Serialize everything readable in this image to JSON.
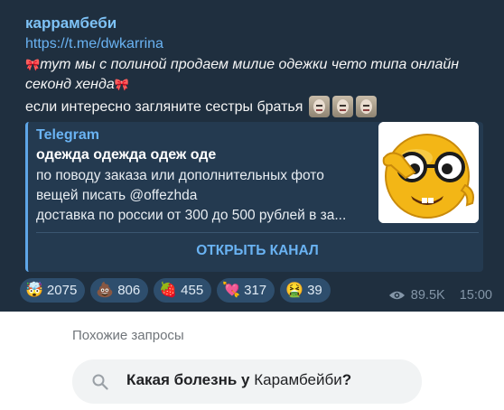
{
  "message": {
    "sender": "каррамбеби",
    "link": "https://t.me/dwkarrina",
    "line1_bow": "🎀",
    "line1_text": "тут мы с полиной продаем милие одежки чето типа онлайн",
    "line2_text": "секонд хенда",
    "line2_bow": "🎀",
    "line3_text": "если интересно загляните сестры братья"
  },
  "preview": {
    "site": "Telegram",
    "title": "одежда одежда одеж оде",
    "lines": [
      "по поводу заказа или дополнительных фото",
      "вещей писать @offezhda",
      "доставка по россии от 300 до 500 рублей в за..."
    ],
    "button": "ОТКРЫТЬ КАНАЛ"
  },
  "reactions": [
    {
      "emoji": "🤯",
      "count": "2075"
    },
    {
      "emoji": "💩",
      "count": "806"
    },
    {
      "emoji": "🍓",
      "count": "455"
    },
    {
      "emoji": "💘",
      "count": "317"
    },
    {
      "emoji": "🤮",
      "count": "39"
    }
  ],
  "meta": {
    "views": "89.5K",
    "time": "15:00"
  },
  "similar": {
    "title": "Похожие запросы",
    "query_bold": "Какая болезнь у",
    "query_normal": " Карамбейби",
    "query_end": "?"
  },
  "colors": {
    "message_bg": "#1f2f3f",
    "accent": "#6ab3f3",
    "reaction_bg": "#2e4e6d",
    "chip_bg": "#f1f3f4"
  }
}
